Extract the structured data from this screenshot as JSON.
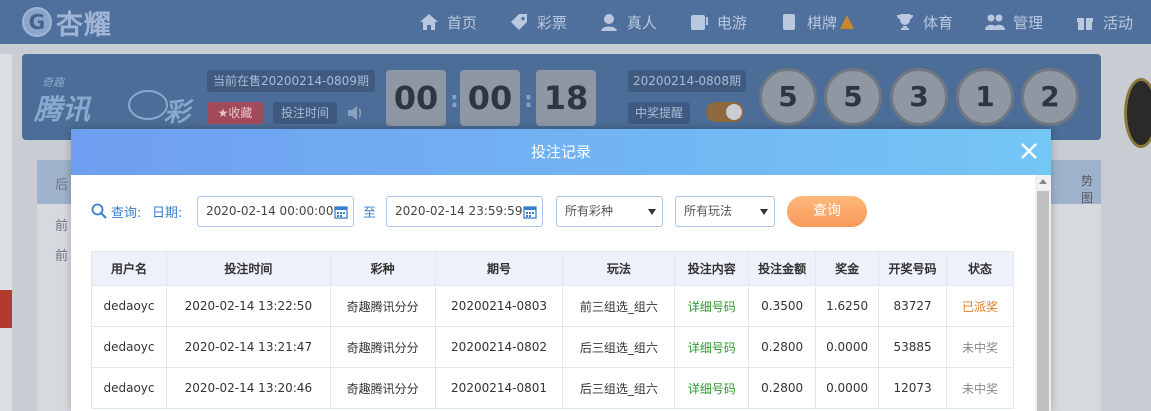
{
  "nav": {
    "logo_text": "杏耀",
    "items": [
      {
        "label": "首页",
        "icon": "home-icon"
      },
      {
        "label": "彩票",
        "icon": "lottery-tag-icon"
      },
      {
        "label": "真人",
        "icon": "live-dealer-icon"
      },
      {
        "label": "电游",
        "icon": "slot-machine-icon"
      },
      {
        "label": "棋牌",
        "icon": "cards-icon"
      },
      {
        "label": "体育",
        "icon": "trophy-icon"
      },
      {
        "label": "管理",
        "icon": "users-icon"
      },
      {
        "label": "活动",
        "icon": "gift-icon"
      }
    ]
  },
  "lottery": {
    "logo_small": "奇趣",
    "logo_main": "腾讯",
    "logo_cai": "彩",
    "current_period": "当前在售20200214-0809期",
    "favorite_label": "★收藏",
    "bet_time_label": "投注时间",
    "countdown": {
      "h": "00",
      "m": "00",
      "s": "18"
    },
    "last_period": "20200214-0808期",
    "win_remind_label": "中奖提醒",
    "balls": [
      "5",
      "5",
      "3",
      "1",
      "2"
    ]
  },
  "background": {
    "row_labels": [
      "后",
      "前",
      "前"
    ],
    "right_label": "势图"
  },
  "modal": {
    "title": "投注记录",
    "query_label": "查询:",
    "date_label": "日期:",
    "date_from": "2020-02-14 00:00:00",
    "to_label": "至",
    "date_to": "2020-02-14 23:59:59",
    "lottery_select": "所有彩种",
    "play_select": "所有玩法",
    "query_button": "查询",
    "columns": [
      "用户名",
      "投注时间",
      "彩种",
      "期号",
      "玩法",
      "投注内容",
      "投注金额",
      "奖金",
      "开奖号码",
      "状态"
    ],
    "rows": [
      {
        "user": "dedaoyc",
        "time": "2020-02-14 13:22:50",
        "lottery": "奇趣腾讯分分",
        "period": "20200214-0803",
        "play": "前三组选_组六",
        "content": "详细号码",
        "amount": "0.3500",
        "prize": "1.6250",
        "numbers": "83727",
        "status": "已派奖",
        "status_type": "won"
      },
      {
        "user": "dedaoyc",
        "time": "2020-02-14 13:21:47",
        "lottery": "奇趣腾讯分分",
        "period": "20200214-0802",
        "play": "后三组选_组六",
        "content": "详细号码",
        "amount": "0.2800",
        "prize": "0.0000",
        "numbers": "53885",
        "status": "未中奖",
        "status_type": "lost"
      },
      {
        "user": "dedaoyc",
        "time": "2020-02-14 13:20:46",
        "lottery": "奇趣腾讯分分",
        "period": "20200214-0801",
        "play": "后三组选_组六",
        "content": "详细号码",
        "amount": "0.2800",
        "prize": "0.0000",
        "numbers": "12073",
        "status": "未中奖",
        "status_type": "lost"
      }
    ]
  },
  "colors": {
    "accent": "#3a7ed0",
    "won": "#e07a1f",
    "detail_link": "#2e9a2e",
    "query_button": "#f79a5a"
  }
}
